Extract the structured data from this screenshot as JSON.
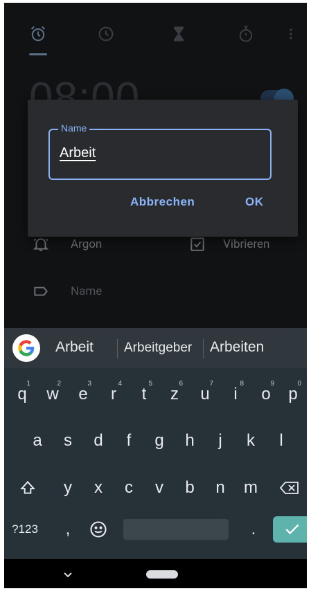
{
  "tabs": [
    {
      "name": "alarm",
      "icon": "alarm-clock-icon",
      "active": true
    },
    {
      "name": "clock",
      "icon": "clock-icon",
      "active": false
    },
    {
      "name": "timer",
      "icon": "hourglass-icon",
      "active": false
    },
    {
      "name": "stopwatch",
      "icon": "stopwatch-icon",
      "active": false
    }
  ],
  "alarm": {
    "time": "08:00",
    "enabled": true,
    "sound": "Argon",
    "vibrate_label": "Vibrieren",
    "vibrate_checked": true,
    "label_placeholder": "Name"
  },
  "dialog": {
    "field_label": "Name",
    "field_value": "Arbeit",
    "cancel": "Abbrechen",
    "ok": "OK"
  },
  "keyboard": {
    "suggestions": [
      "Arbeit",
      "Arbeitgeber",
      "Arbeiten"
    ],
    "row1": [
      "q",
      "w",
      "e",
      "r",
      "t",
      "z",
      "u",
      "i",
      "o",
      "p"
    ],
    "row1_numbers": [
      "1",
      "2",
      "3",
      "4",
      "5",
      "6",
      "7",
      "8",
      "9",
      "0"
    ],
    "row2": [
      "a",
      "s",
      "d",
      "f",
      "g",
      "h",
      "j",
      "k",
      "l"
    ],
    "row3": [
      "y",
      "x",
      "c",
      "v",
      "b",
      "n",
      "m"
    ],
    "symbols_key": "?123",
    "comma": ",",
    "period": "."
  },
  "colors": {
    "accent": "#8ab4f8",
    "dialog_bg": "#2a2b2f",
    "keyboard_bg": "#263238",
    "enter_key": "#5fb3ad"
  }
}
